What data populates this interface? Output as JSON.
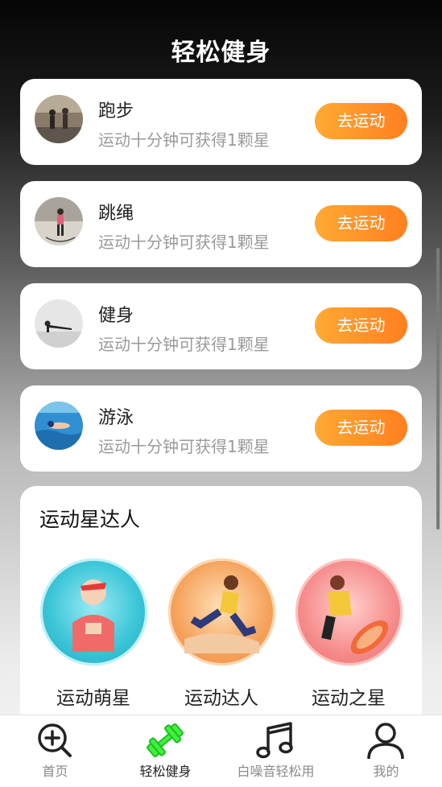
{
  "header": {
    "title": "轻松健身"
  },
  "activities": [
    {
      "name": "跑步",
      "reward": "运动十分钟可获得1颗星",
      "button": "去运动",
      "image": "running-photo"
    },
    {
      "name": "跳绳",
      "reward": "运动十分钟可获得1颗星",
      "button": "去运动",
      "image": "jump-rope-photo"
    },
    {
      "name": "健身",
      "reward": "运动十分钟可获得1颗星",
      "button": "去运动",
      "image": "plank-photo"
    },
    {
      "name": "游泳",
      "reward": "运动十分钟可获得1颗星",
      "button": "去运动",
      "image": "swimming-photo"
    }
  ],
  "stars": {
    "title": "运动星达人",
    "badges": [
      {
        "label": "运动萌星",
        "color": "#3cc6d8"
      },
      {
        "label": "运动达人",
        "color": "#f5a15a"
      },
      {
        "label": "运动之星",
        "color": "#f58a8a"
      }
    ]
  },
  "tabbar": {
    "items": [
      {
        "label": "首页",
        "icon": "search-plus-icon",
        "active": false
      },
      {
        "label": "轻松健身",
        "icon": "dumbbell-icon",
        "active": true
      },
      {
        "label": "白噪音轻松用",
        "icon": "music-note-icon",
        "active": false
      },
      {
        "label": "我的",
        "icon": "person-icon",
        "active": false
      }
    ]
  },
  "colors": {
    "accent_start": "#ffaa33",
    "accent_end": "#ff7f20",
    "active_tab_icon": "#2ee82e"
  }
}
